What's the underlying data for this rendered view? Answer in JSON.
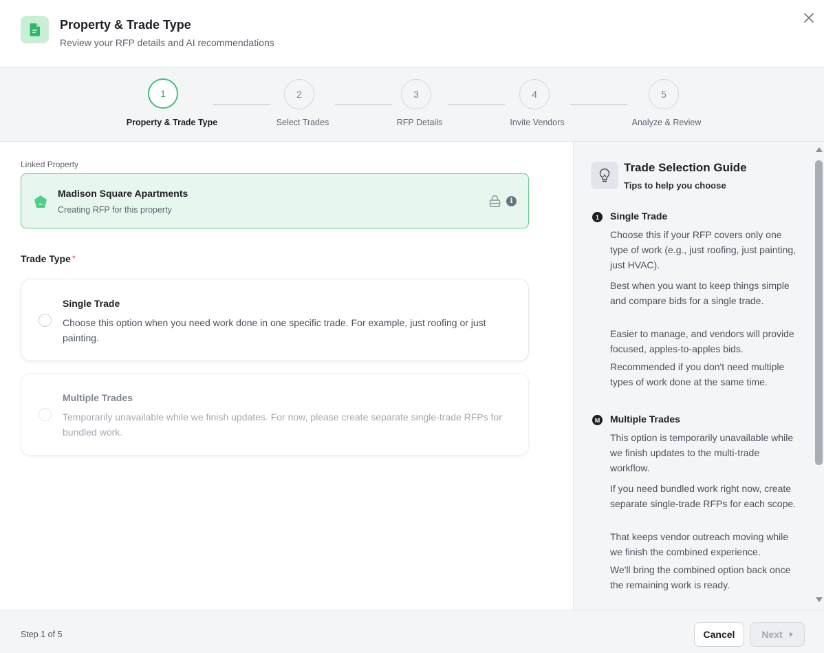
{
  "header": {
    "title": "Property & Trade Type",
    "subtitle": "Review your RFP details and AI recommendations",
    "icon": "document-icon",
    "accent": "#3cc27a"
  },
  "stepper": {
    "steps": [
      {
        "number": "1",
        "label": "Property & Trade Type",
        "state": "active"
      },
      {
        "number": "2",
        "label": "Select Trades",
        "state": "upcoming"
      },
      {
        "number": "3",
        "label": "RFP Details",
        "state": "upcoming"
      },
      {
        "number": "4",
        "label": "Invite Vendors",
        "state": "upcoming"
      },
      {
        "number": "5",
        "label": "Analyze & Review",
        "state": "upcoming"
      }
    ]
  },
  "linked_property": {
    "label": "Linked Property",
    "name": "Madison Square Apartments",
    "sub": "Creating RFP for this property",
    "info_glyph": "i"
  },
  "trade_type": {
    "label": "Trade Type",
    "required_mark": "*",
    "options": [
      {
        "title": "Single Trade",
        "description": "Choose this option when you need work done in one specific trade. For example, just roofing or just painting.",
        "selected": false,
        "disabled": false
      },
      {
        "title": "Multiple Trades",
        "description": "Temporarily unavailable while we finish updates. For now, please create separate single-trade RFPs for bundled work.",
        "selected": false,
        "disabled": true
      }
    ]
  },
  "guide": {
    "title": "Trade Selection Guide",
    "subtitle": "Tips to help you choose",
    "sections": [
      {
        "badge": "1",
        "title": "Single Trade",
        "paragraphs": [
          "Choose this if your RFP covers only one type of work (e.g., just roofing, just painting, just HVAC).",
          "Best when you want to keep things simple and compare bids for a single trade.",
          "Easier to manage, and vendors will provide focused, apples-to-apples bids.",
          "Recommended if you don't need multiple types of work done at the same time."
        ]
      },
      {
        "badge": "M",
        "title": "Multiple Trades",
        "paragraphs": [
          "This option is temporarily unavailable while we finish updates to the multi-trade workflow.",
          "If you need bundled work right now, create separate single-trade RFPs for each scope.",
          "That keeps vendor outreach moving while we finish the combined experience.",
          "We'll bring the combined option back once the remaining work is ready."
        ]
      }
    ]
  },
  "footer": {
    "step_count": "Step 1 of 5",
    "cancel_label": "Cancel",
    "next_label": "Next",
    "next_disabled": true
  }
}
